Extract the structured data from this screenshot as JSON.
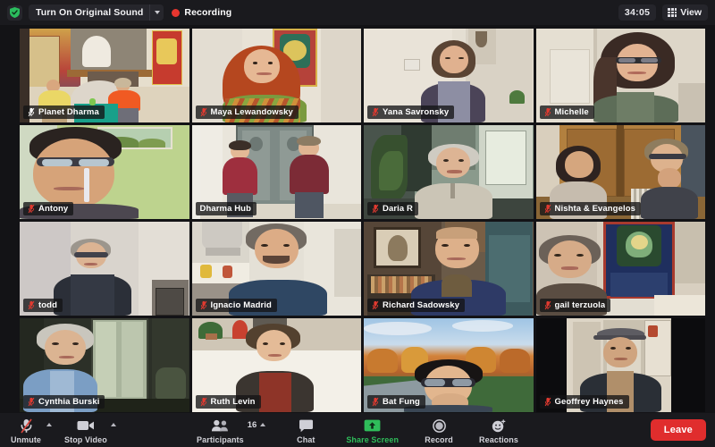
{
  "topbar": {
    "shield_icon": "shield-check-icon",
    "original_sound_label": "Turn On Original Sound",
    "dropdown_icon": "chevron-down-icon",
    "recording_label": "Recording",
    "recording_dot_color": "#e8362f",
    "timer": "34:05",
    "view_label": "View",
    "view_icon": "grid-icon"
  },
  "grid": {
    "rows": 4,
    "cols": 4,
    "active_border_color": "#c3e03b",
    "tiles": [
      {
        "name": "Planet Dharma",
        "muted": true,
        "mic_color": "#ffffff",
        "active": true
      },
      {
        "name": "Maya Lewandowsky",
        "muted": true,
        "mic_color": "#e23a30",
        "active": false
      },
      {
        "name": "Yana Savronsky",
        "muted": true,
        "mic_color": "#e23a30",
        "active": false
      },
      {
        "name": "Michelle",
        "muted": true,
        "mic_color": "#e23a30",
        "active": false
      },
      {
        "name": "Antony",
        "muted": true,
        "mic_color": "#e23a30",
        "active": false
      },
      {
        "name": "Dharma Hub",
        "muted": false,
        "mic_color": "",
        "active": false
      },
      {
        "name": "Daria R",
        "muted": true,
        "mic_color": "#e23a30",
        "active": false
      },
      {
        "name": "Nishta & Evangelos",
        "muted": true,
        "mic_color": "#e23a30",
        "active": false
      },
      {
        "name": "todd",
        "muted": true,
        "mic_color": "#e23a30",
        "active": false
      },
      {
        "name": "Ignacio Madrid",
        "muted": true,
        "mic_color": "#e23a30",
        "active": false
      },
      {
        "name": "Richard Sadowsky",
        "muted": true,
        "mic_color": "#e23a30",
        "active": false
      },
      {
        "name": "gail terzuola",
        "muted": true,
        "mic_color": "#e23a30",
        "active": false
      },
      {
        "name": "Cynthia Burski",
        "muted": true,
        "mic_color": "#e23a30",
        "active": false
      },
      {
        "name": "Ruth Levin",
        "muted": true,
        "mic_color": "#e23a30",
        "active": false
      },
      {
        "name": "Bat Fung",
        "muted": true,
        "mic_color": "#e23a30",
        "active": false
      },
      {
        "name": "Geoffrey Haynes",
        "muted": true,
        "mic_color": "#e23a30",
        "active": false
      }
    ]
  },
  "toolbar": {
    "unmute_label": "Unmute",
    "unmute_icon": "microphone-muted-icon",
    "stop_video_label": "Stop Video",
    "stop_video_icon": "video-camera-icon",
    "participants_label": "Participants",
    "participants_icon": "people-icon",
    "participants_count": "16",
    "chat_label": "Chat",
    "chat_icon": "speech-bubble-icon",
    "share_screen_label": "Share Screen",
    "share_screen_icon": "share-screen-icon",
    "share_screen_color": "#2fbd5a",
    "record_label": "Record",
    "record_icon": "record-circle-icon",
    "reactions_label": "Reactions",
    "reactions_icon": "smiley-reaction-icon",
    "leave_label": "Leave",
    "leave_color": "#e02d2d",
    "caret_icon": "chevron-up-icon"
  }
}
